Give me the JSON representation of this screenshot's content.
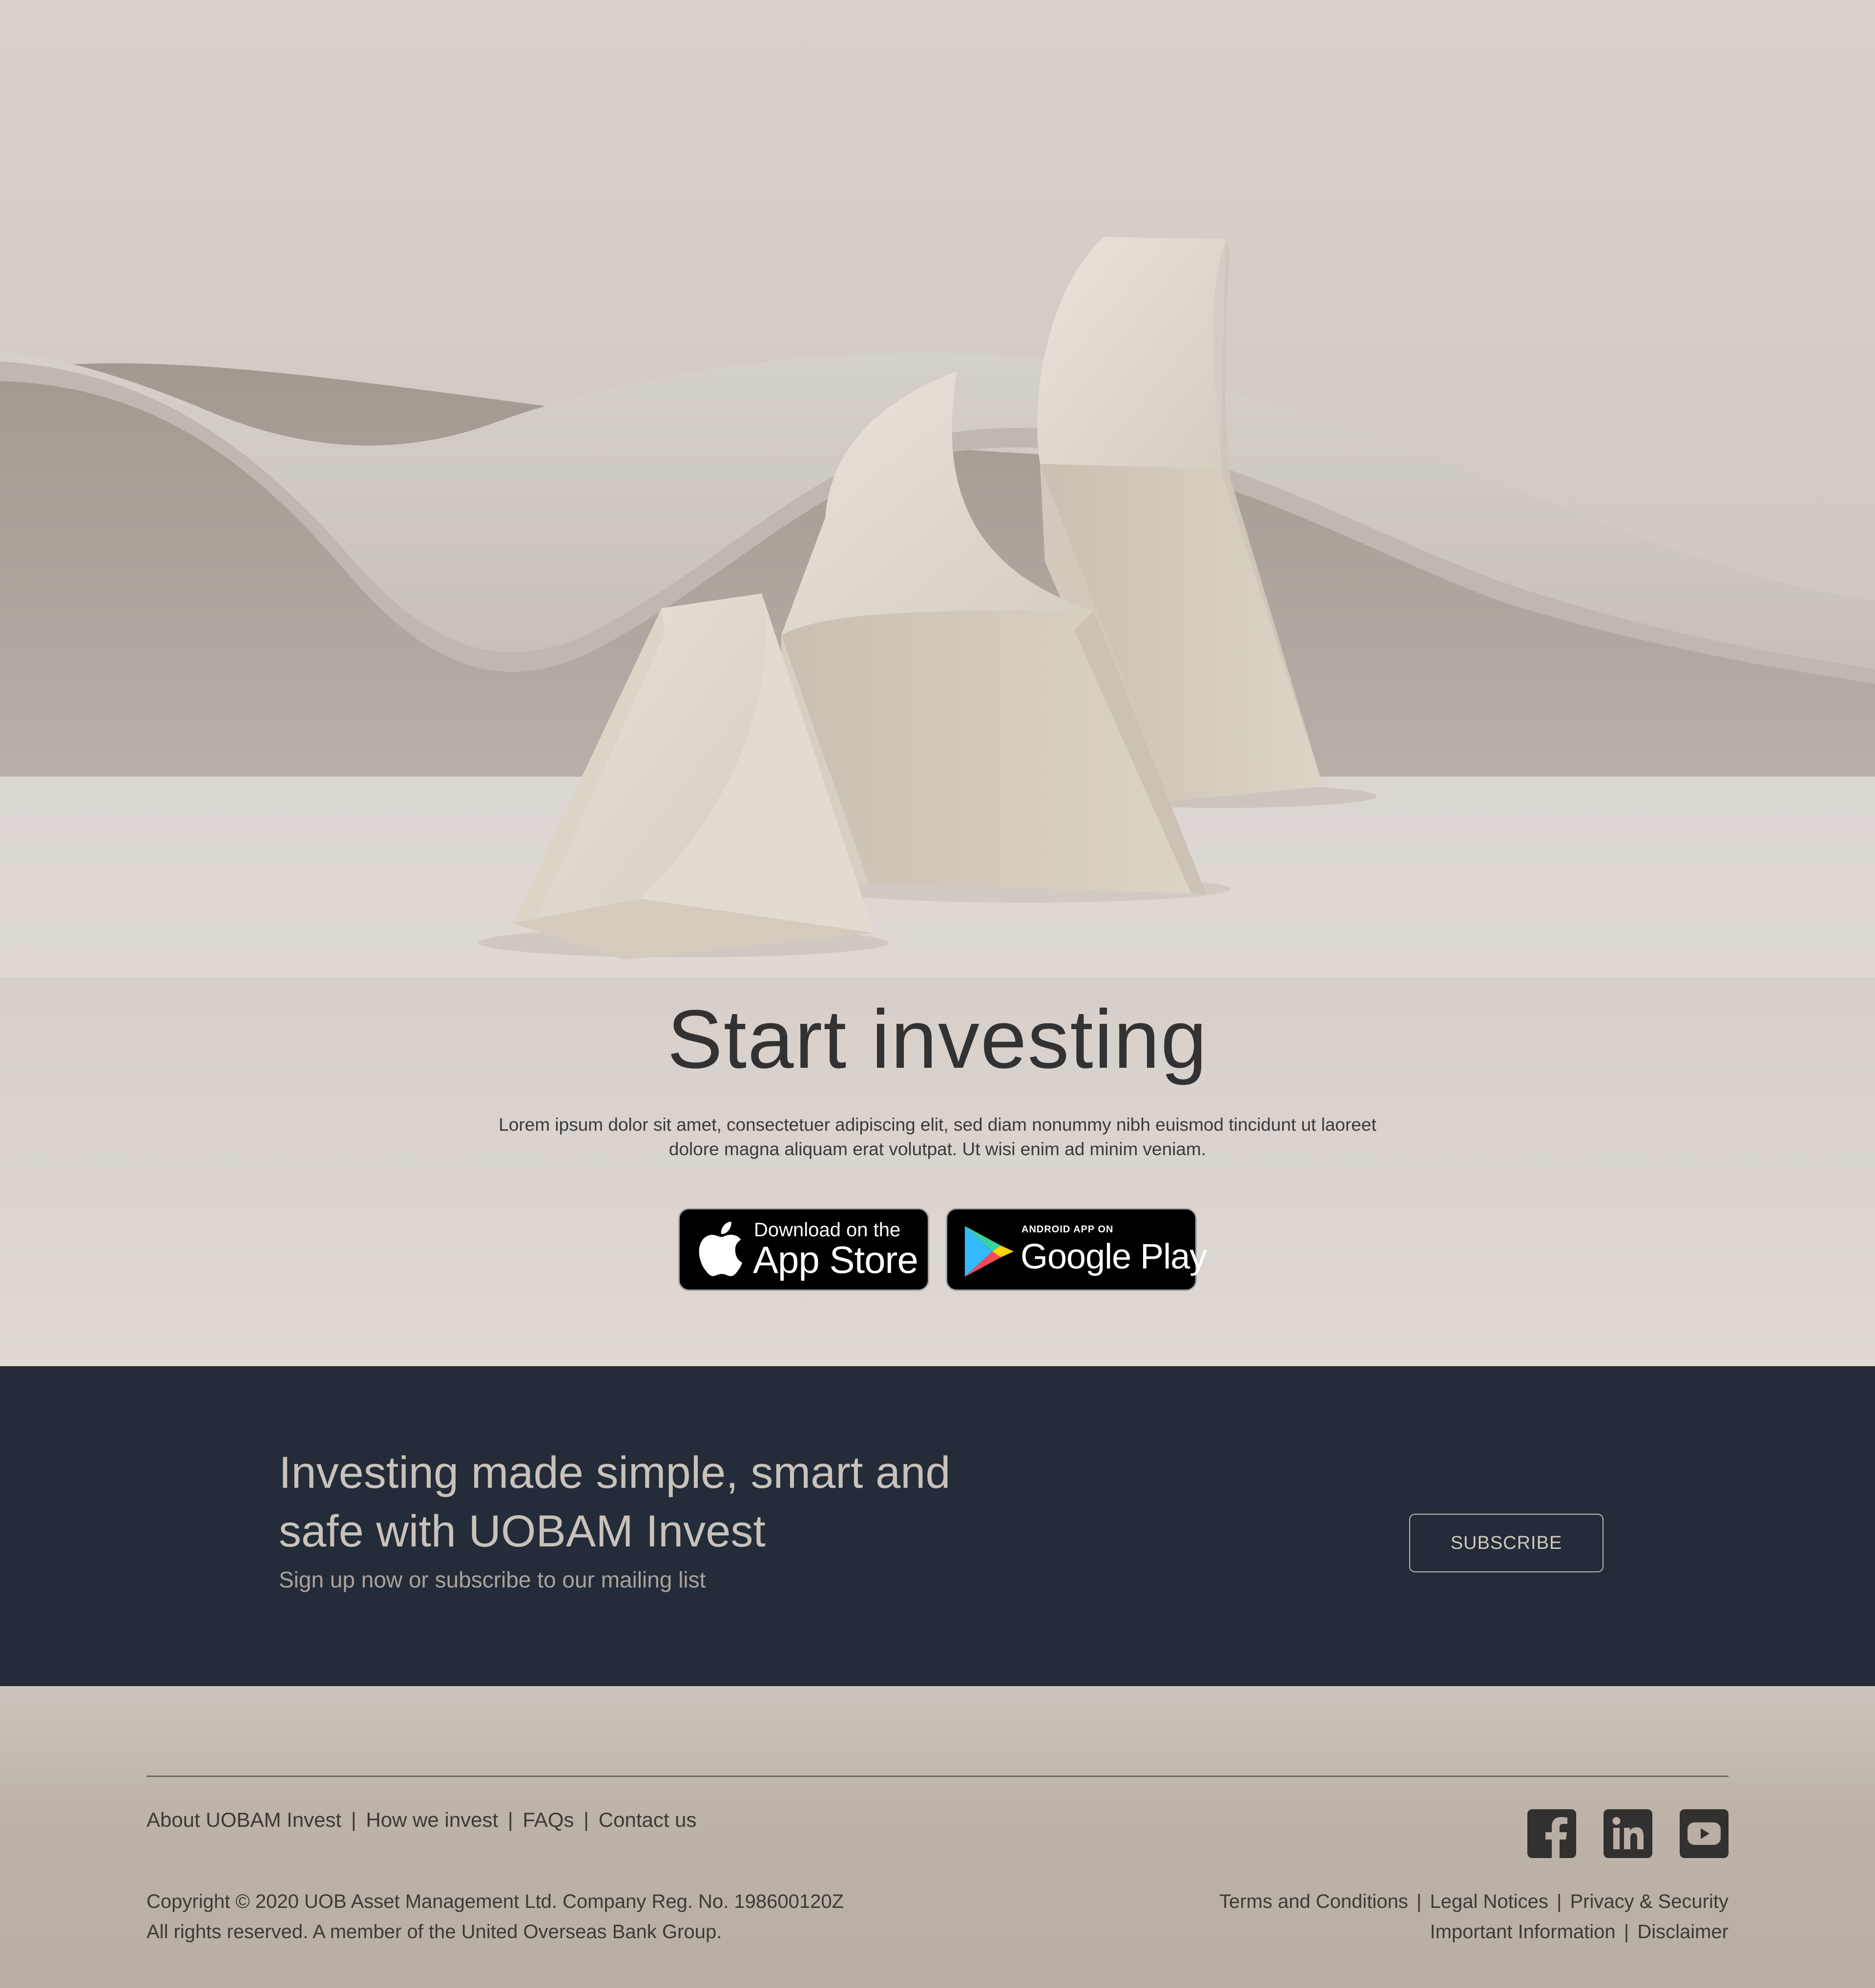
{
  "hero": {
    "title": "Start investing",
    "description": "Lorem ipsum dolor sit amet, consectetuer adipiscing elit, sed diam nonummy nibh euismod tincidunt ut laoreet dolore magna aliquam erat volutpat. Ut wisi enim ad minim veniam.",
    "app_store": {
      "small": "Download on the",
      "big": "App Store"
    },
    "google_play": {
      "small": "ANDROID APP ON",
      "big": "Google Play"
    }
  },
  "band": {
    "title": "Investing made simple, smart and safe with UOBAM Invest",
    "subtitle": "Sign up now or subscribe to our mailing list",
    "subscribe_label": "SUBSCRIBE"
  },
  "footer": {
    "nav": {
      "about": "About UOBAM Invest",
      "how": "How we invest",
      "faqs": "FAQs",
      "contact": "Contact us",
      "separator": "|"
    },
    "social": [
      "facebook-icon",
      "linkedin-icon",
      "youtube-icon"
    ],
    "copyright_line1": "Copyright © 2020 UOB Asset Management Ltd. Company Reg. No. 198600120Z",
    "copyright_line2": "All rights reserved. A member of the United Overseas Bank Group.",
    "legal": {
      "terms": "Terms and Conditions",
      "notices": "Legal Notices",
      "privacy": "Privacy & Security",
      "important": "Important Information",
      "disclaimer": "Disclaimer",
      "separator": "|"
    }
  },
  "colors": {
    "band_bg": "#232c38",
    "hero_bg": "#dfd8d3",
    "footer_bg": "#bdb3a9",
    "text_dark": "#333232"
  }
}
